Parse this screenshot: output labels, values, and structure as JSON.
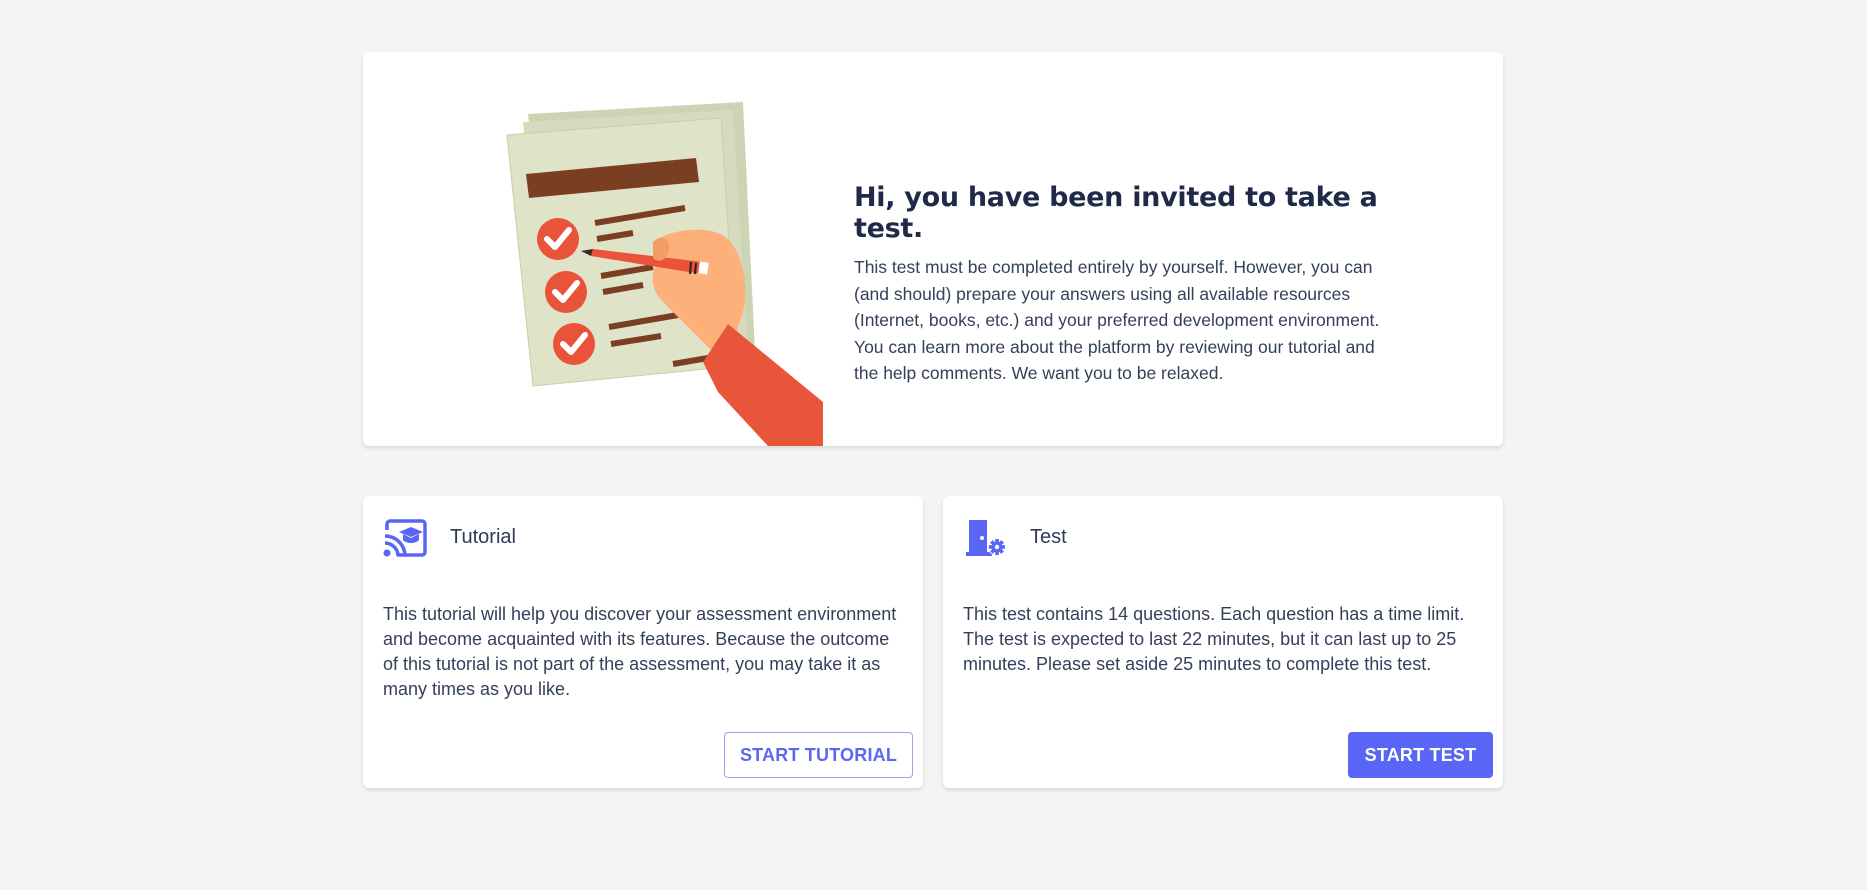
{
  "hero": {
    "title": "Hi, you have been invited to take a test.",
    "description": "This test must be completed entirely by yourself. However, you can (and should) prepare your answers using all available resources (Internet, books, etc.) and your preferred development environment. You can learn more about the platform by reviewing our tutorial and the help comments. We want you to be relaxed.",
    "illustration": "checklist-hand-pencil-illustration"
  },
  "tutorial_card": {
    "icon": "cast-graduation-icon",
    "title": "Tutorial",
    "body": "This tutorial will help you discover your assessment environment and become acquainted with its features. Because the outcome of this tutorial is not part of the assessment, you may take it as many times as you like.",
    "button_label": "START TUTORIAL"
  },
  "test_card": {
    "icon": "door-gear-icon",
    "title": "Test",
    "body": "This test contains 14 questions. Each question has a time limit. The test is expected to last 22 minutes, but it can last up to 25 minutes. Please set aside 25 minutes to complete this test.",
    "button_label": "START TEST"
  },
  "colors": {
    "accent": "#5865f5",
    "background": "#f4f4f5",
    "card": "#ffffff",
    "check_red": "#e9533a",
    "paper": "#dfe3c8"
  }
}
